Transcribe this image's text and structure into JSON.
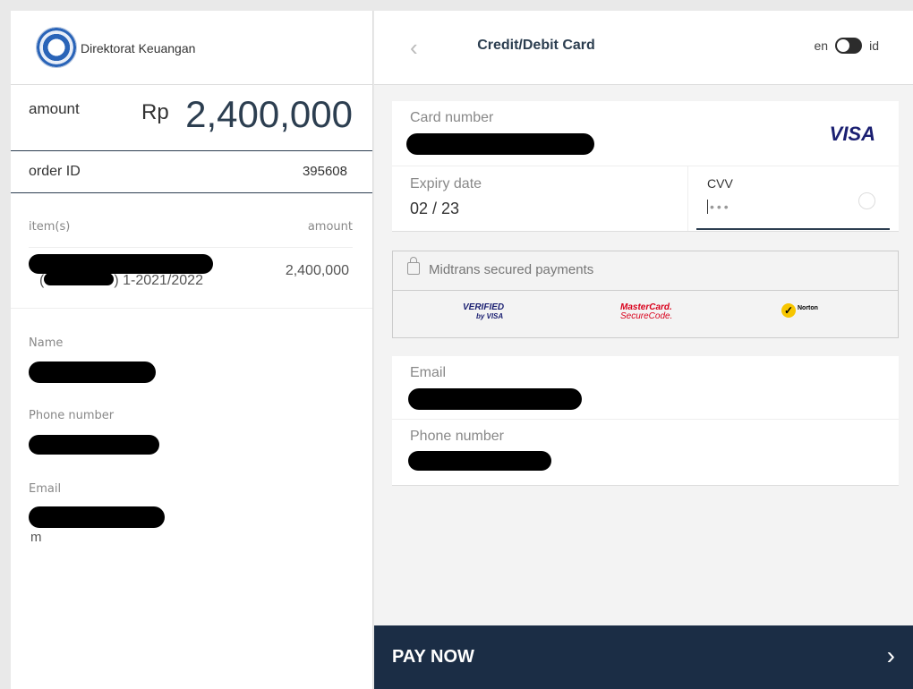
{
  "merchant": {
    "name": "Direktorat Keuangan"
  },
  "summary": {
    "amount_label": "amount",
    "currency": "Rp",
    "amount": "2,400,000",
    "order_label": "order ID",
    "order_id": "395608"
  },
  "items": {
    "header_items": "item(s)",
    "header_amount": "amount",
    "rows": [
      {
        "name_suffix": ") 1-2021/2022",
        "name_prefix": "(",
        "amount": "2,400,000"
      }
    ]
  },
  "customer": {
    "name_label": "Name",
    "phone_label": "Phone number",
    "email_label": "Email",
    "email_suffix": "m"
  },
  "header": {
    "title": "Credit/Debit Card",
    "lang_en": "en",
    "lang_id": "id"
  },
  "card_form": {
    "card_number_label": "Card number",
    "brand": "VISA",
    "expiry_label": "Expiry date",
    "expiry_value": "02 / 23",
    "cvv_label": "CVV",
    "cvv_value": "•••"
  },
  "security": {
    "text": "Midtrans secured payments",
    "badge_visa_line1": "VERIFIED",
    "badge_visa_line2": "by VISA",
    "badge_mc_line1": "MasterCard.",
    "badge_mc_line2": "SecureCode.",
    "badge_norton": "Norton"
  },
  "contact_form": {
    "email_label": "Email",
    "phone_label": "Phone number"
  },
  "pay": {
    "label": "PAY NOW"
  },
  "icons": {
    "back": "chevron-left-icon",
    "pay": "chevron-right-icon",
    "lock": "lock-icon",
    "logo": "merchant-logo"
  }
}
